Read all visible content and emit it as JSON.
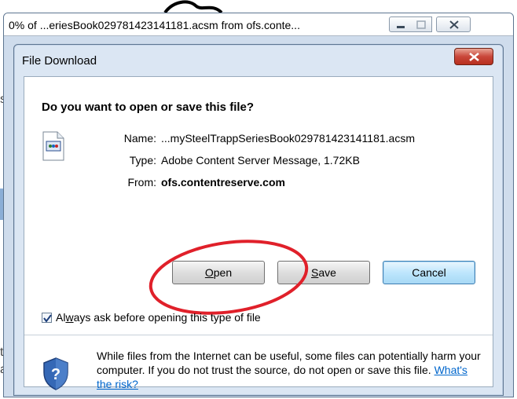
{
  "window": {
    "title": "0% of ...eriesBook029781423141181.acsm from ofs.conte..."
  },
  "background": {
    "fragments": [
      "s",
      "ti",
      "a"
    ]
  },
  "dialog": {
    "title": "File Download",
    "question": "Do you want to open or save this file?",
    "name_label": "Name:",
    "name_value": "...mySteelTrappSeriesBook029781423141181.acsm",
    "type_label": "Type:",
    "type_value": "Adobe Content Server Message, 1.72KB",
    "from_label": "From:",
    "from_value": "ofs.contentreserve.com",
    "buttons": {
      "open_pre": "",
      "open_key": "O",
      "open_post": "pen",
      "save_pre": "",
      "save_key": "S",
      "save_post": "ave",
      "cancel": "Cancel"
    },
    "checkbox": {
      "checked": true,
      "label_pre": "Al",
      "label_key": "w",
      "label_post": "ays ask before opening this type of file"
    },
    "warning": {
      "text": "While files from the Internet can be useful, some files can potentially harm your computer. If you do not trust the source, do not open or save this file.",
      "link": "What's the risk?"
    }
  },
  "colors": {
    "annotation": "#e0202a",
    "link": "#0066cc"
  }
}
